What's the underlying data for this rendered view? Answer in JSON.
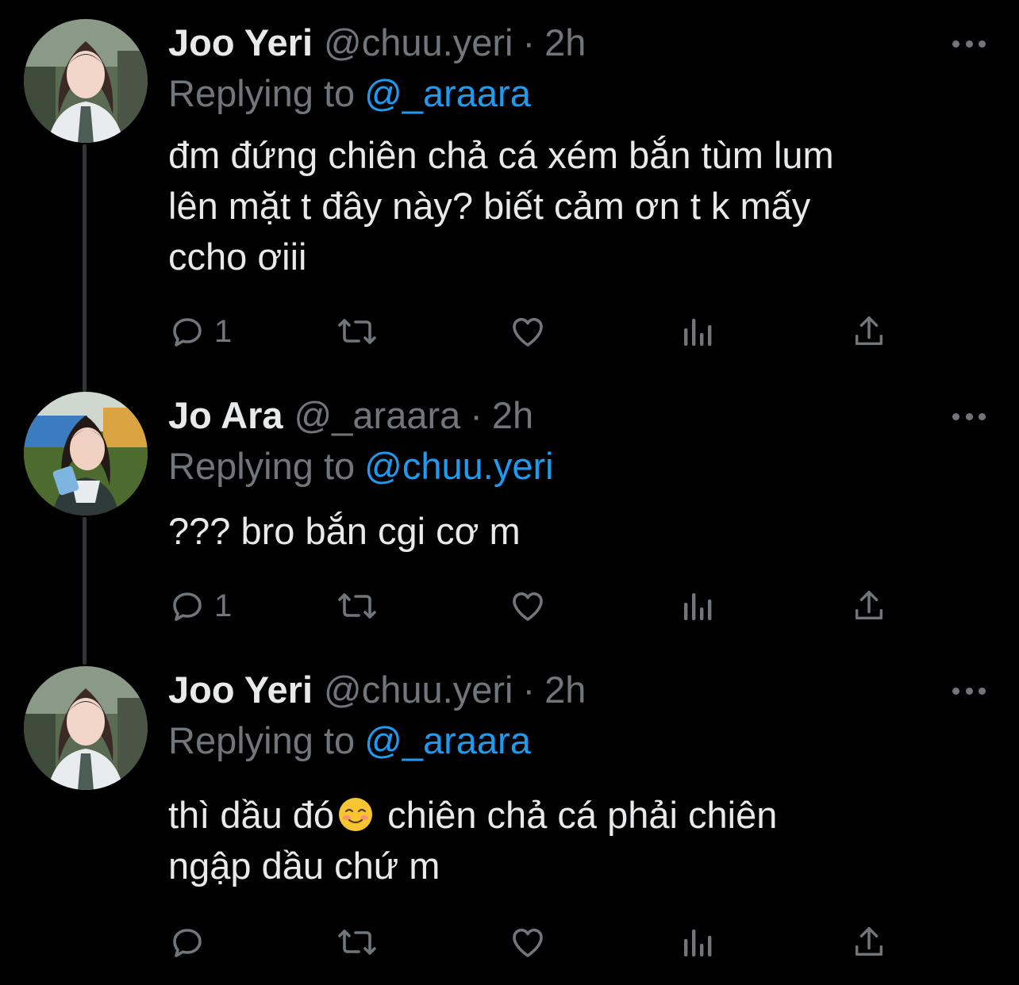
{
  "colors": {
    "background": "#000000",
    "text_primary": "#e7e9ea",
    "text_secondary": "#71767b",
    "accent": "#1d9bf0",
    "thread_line": "#333639"
  },
  "tweets": [
    {
      "name": "Joo Yeri",
      "handle": "@chuu.yeri",
      "separator": "·",
      "time": "2h",
      "replying_label": "Replying to",
      "replying_to": "@_araara",
      "text": "đm đứng chiên chả cá xém bắn tùm lum\nlên mặt t đây này? biết cảm ơn t k mấy\nccho ơiii",
      "reply_count": "1",
      "avatar_icon": "avatar-photo"
    },
    {
      "name": "Jo Ara",
      "handle": "@_araara",
      "separator": "·",
      "time": "2h",
      "replying_label": "Replying to",
      "replying_to": "@chuu.yeri",
      "text": "??? bro bắn cgi cơ m",
      "reply_count": "1",
      "avatar_icon": "avatar-photo"
    },
    {
      "name": "Joo Yeri",
      "handle": "@chuu.yeri",
      "separator": "·",
      "time": "2h",
      "replying_label": "Replying to",
      "replying_to": "@_araara",
      "text_before_emoji": "thì dầu đó",
      "emoji": "smiling-face-emoji",
      "text_after_emoji": " chiên chả cá phải chiên\nngập dầu chứ m",
      "reply_count": "",
      "avatar_icon": "avatar-photo"
    }
  ],
  "action_icons": [
    "reply-icon",
    "retweet-icon",
    "like-icon",
    "views-icon",
    "share-icon"
  ]
}
